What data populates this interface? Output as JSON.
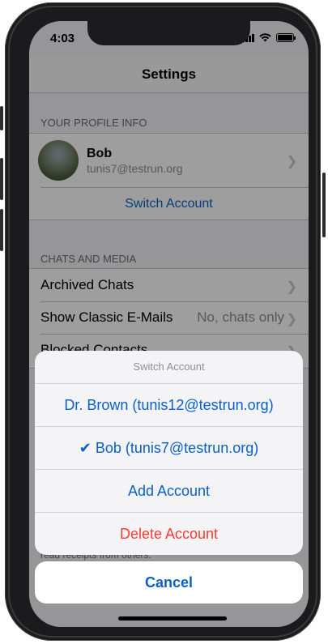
{
  "status_bar": {
    "time": "4:03"
  },
  "navbar": {
    "title": "Settings"
  },
  "profile_section": {
    "header": "YOUR PROFILE INFO",
    "name": "Bob",
    "email": "tunis7@testrun.org",
    "switch_account": "Switch Account"
  },
  "chats_section": {
    "header": "CHATS AND MEDIA",
    "rows": [
      {
        "label": "Archived Chats",
        "value": ""
      },
      {
        "label": "Show Classic E-Mails",
        "value": "No, chats only"
      },
      {
        "label": "Blocked Contacts",
        "value": ""
      }
    ],
    "footer_text": "read receipts from others."
  },
  "action_sheet": {
    "title": "Switch Account",
    "options": [
      {
        "label": "Dr. Brown (tunis12@testrun.org)",
        "color": "#0a60c8"
      },
      {
        "label": "✔ Bob (tunis7@testrun.org)",
        "color": "#0a60c8"
      },
      {
        "label": "Add Account",
        "color": "#0a60c8"
      },
      {
        "label": "Delete Account",
        "color": "#ff3b30"
      }
    ],
    "cancel": "Cancel"
  },
  "colors": {
    "accent": "#0a60c8",
    "destructive": "#ff3b30"
  }
}
